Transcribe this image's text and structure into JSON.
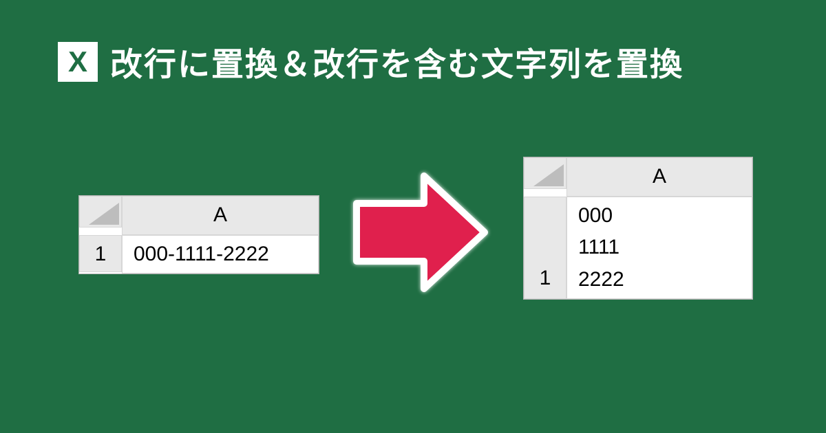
{
  "logo_letter": "X",
  "title": "改行に置換＆改行を含む文字列を置換",
  "table_left": {
    "column_header": "A",
    "row_number": "1",
    "cell_value": "000-1111-2222"
  },
  "table_right": {
    "column_header": "A",
    "row_number": "1",
    "cell_value": "000\n1111\n2222"
  },
  "colors": {
    "background": "#1f6e43",
    "arrow": "#e0204d"
  }
}
